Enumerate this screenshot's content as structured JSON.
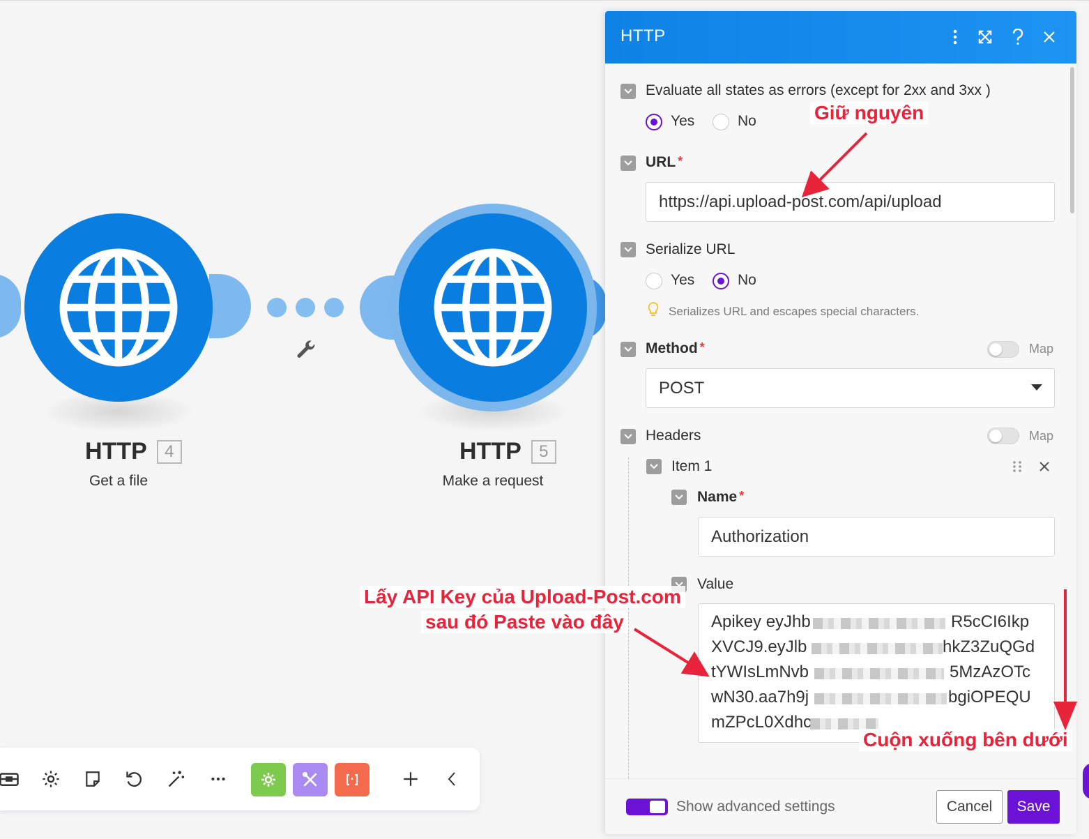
{
  "nodes": [
    {
      "title": "HTTP",
      "number": "4",
      "subtitle": "Get a file"
    },
    {
      "title": "HTTP",
      "number": "5",
      "subtitle": "Make a request"
    }
  ],
  "panel": {
    "title": "HTTP",
    "evaluate": {
      "label": "Evaluate all states as errors (except for 2xx and 3xx )",
      "yes": "Yes",
      "no": "No",
      "selected": "Yes"
    },
    "url": {
      "label": "URL",
      "required": "*",
      "value": "https://api.upload-post.com/api/upload"
    },
    "serialize": {
      "label": "Serialize URL",
      "yes": "Yes",
      "no": "No",
      "selected": "No",
      "hint": "Serializes URL and escapes special characters."
    },
    "method": {
      "label": "Method",
      "required": "*",
      "map": "Map",
      "value": "POST"
    },
    "headers": {
      "label": "Headers",
      "map": "Map",
      "item": {
        "label": "Item 1",
        "name": {
          "label": "Name",
          "required": "*",
          "value": "Authorization"
        },
        "value": {
          "label": "Value",
          "lines": [
            "Apikey eyJhb",
            "R5cCI6Ikp",
            "XVCJ9.eyJlb",
            "hkZ3ZuQGd",
            "tYWIsLmNvb",
            "5MzAzOTc",
            "wN30.aa7h9j",
            "bgiOPEQU",
            "mZPcL0Xdhc"
          ]
        }
      }
    },
    "footer": {
      "advanced": "Show advanced settings",
      "cancel": "Cancel",
      "save": "Save"
    }
  },
  "annotations": {
    "keep": "Giữ nguyên",
    "api_key_line1": "Lấy API Key của Upload-Post.com",
    "api_key_line2": "sau đó Paste vào đây",
    "scroll": "Cuộn xuống bên dưới"
  },
  "colors": {
    "brand_blue": "#0a7de0",
    "accent_purple": "#6b12d6",
    "annotation_red": "#e8243a"
  }
}
